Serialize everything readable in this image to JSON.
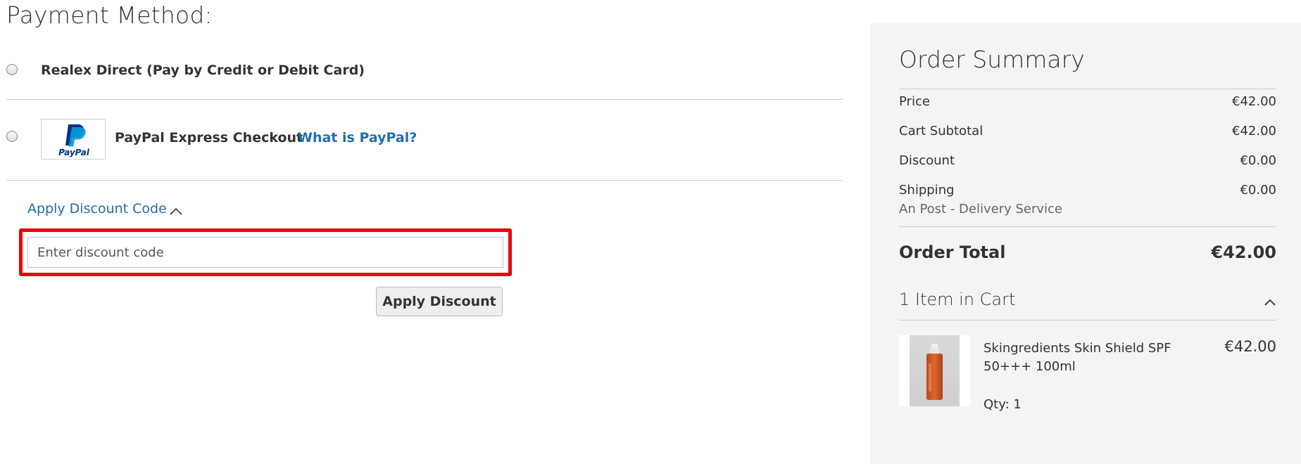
{
  "payment": {
    "title": "Payment Method:",
    "methods": [
      {
        "label": "Realex Direct (Pay by Credit or Debit Card)",
        "selected": false
      },
      {
        "label": "PayPal Express Checkout",
        "selected": false,
        "logo_text": "PayPal",
        "link": "What is PayPal?"
      }
    ]
  },
  "discount": {
    "toggle_label": "Apply Discount Code",
    "expanded": true,
    "input_placeholder": "Enter discount code",
    "input_value": "",
    "button_label": "Apply Discount",
    "highlight_color": "#e8000b"
  },
  "summary": {
    "title": "Order Summary",
    "rows": [
      {
        "label": "Price",
        "value": "€42.00"
      },
      {
        "label": "Cart Subtotal",
        "value": "€42.00"
      },
      {
        "label": "Discount",
        "value": "€0.00"
      },
      {
        "label": "Shipping",
        "value": "€0.00",
        "detail": "An Post - Delivery Service"
      }
    ],
    "total_label": "Order Total",
    "total_value": "€42.00",
    "items_label": "1 Item in Cart",
    "items_expanded": true,
    "items": [
      {
        "name": "Skingredients Skin Shield SPF 50+++ 100ml",
        "price": "€42.00",
        "qty": "Qty: 1"
      }
    ]
  },
  "colors": {
    "link": "#1f6fb0",
    "summary_bg": "#f4f4f4",
    "divider": "#cccccc",
    "highlight": "#e8000b",
    "paypal_dark": "#003087",
    "paypal_light": "#009cde"
  },
  "icons": {
    "discount_toggle": "chevron-up-icon",
    "items_toggle": "chevron-up-icon"
  }
}
